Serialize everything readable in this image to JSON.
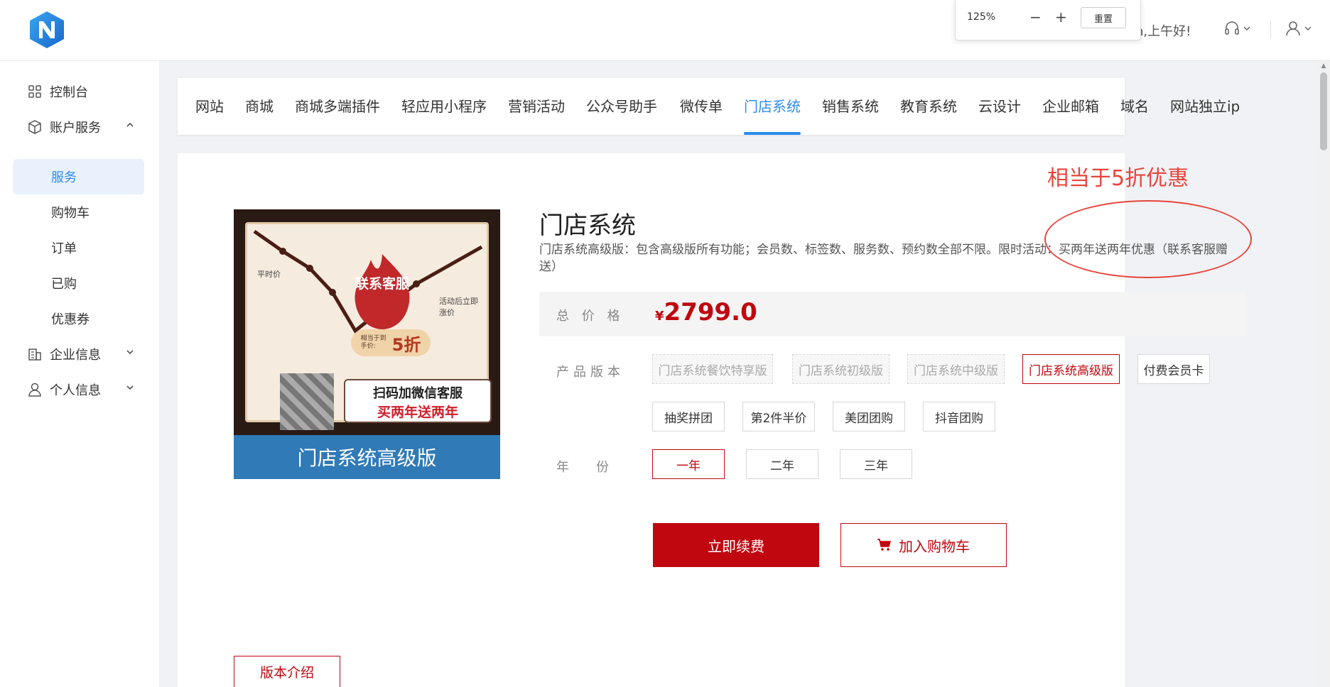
{
  "header": {
    "greeting": "n,上午好!",
    "zoom": {
      "value": "125%",
      "minus": "−",
      "plus": "+",
      "reset": "重置"
    }
  },
  "sidebar": {
    "items": [
      {
        "label": "控制台",
        "icon": "grid-icon"
      },
      {
        "label": "账户服务",
        "icon": "box-icon"
      },
      {
        "label": "服务"
      },
      {
        "label": "购物车"
      },
      {
        "label": "订单"
      },
      {
        "label": "已购"
      },
      {
        "label": "优惠券"
      },
      {
        "label": "企业信息",
        "icon": "building-icon"
      },
      {
        "label": "个人信息",
        "icon": "user-icon"
      }
    ]
  },
  "tabs": [
    "网站",
    "商城",
    "商城多端插件",
    "轻应用小程序",
    "营销活动",
    "公众号助手",
    "微传单",
    "门店系统",
    "销售系统",
    "教育系统",
    "云设计",
    "企业邮箱",
    "域名",
    "网站独立ip"
  ],
  "promo": {
    "annotation": "相当于5折优惠"
  },
  "product_image": {
    "label_normal": "平时价",
    "label_after": "活动后立即涨价",
    "flame_text": "联系客服",
    "pill_small": "相当于到手价:",
    "pill_big": "5折",
    "box_line1": "扫码加微信客服",
    "box_line2": "买两年送两年",
    "bar": "门店系统高级版"
  },
  "product": {
    "title": "门店系统",
    "desc": "门店系统高级版：包含高级版所有功能；会员数、标签数、服务数、预约数全部不限。限时活动：买两年送两年优惠（联系客服赠送）",
    "price_label": "总 价 格",
    "currency": "¥",
    "price": "2799.0",
    "version_label": "产品版本",
    "versions": [
      {
        "label": "门店系统餐饮特享版",
        "state": "disabled"
      },
      {
        "label": "门店系统初级版",
        "state": "disabled"
      },
      {
        "label": "门店系统中级版",
        "state": "disabled"
      },
      {
        "label": "门店系统高级版",
        "state": "selected"
      },
      {
        "label": "付费会员卡",
        "state": "normal"
      },
      {
        "label": "抽奖拼团",
        "state": "normal"
      },
      {
        "label": "第2件半价",
        "state": "normal"
      },
      {
        "label": "美团团购",
        "state": "normal"
      },
      {
        "label": "抖音团购",
        "state": "normal"
      }
    ],
    "year_label": "年　份",
    "years": [
      {
        "label": "一年",
        "state": "selected"
      },
      {
        "label": "二年",
        "state": "normal"
      },
      {
        "label": "三年",
        "state": "normal"
      }
    ],
    "buy_button": "立即续费",
    "cart_button": "加入购物车"
  },
  "intro_tab": "版本介绍",
  "colors": {
    "accent_blue": "#2d8cf0",
    "accent_red": "#c0070f",
    "annotation_red": "#e8453c"
  }
}
